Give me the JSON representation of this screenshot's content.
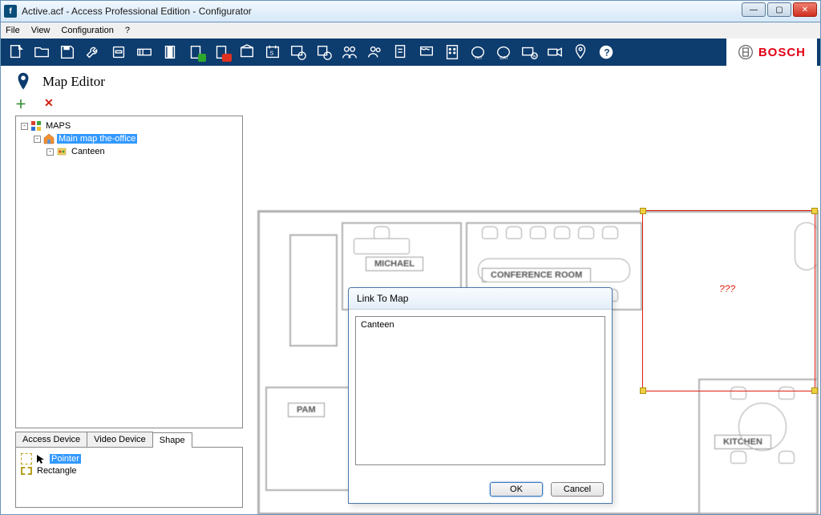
{
  "window": {
    "title": "Active.acf - Access Professional Edition - Configurator",
    "app_icon_glyph": "f"
  },
  "menu": {
    "items": [
      "File",
      "View",
      "Configuration",
      "?"
    ]
  },
  "brand": {
    "text": "BOSCH"
  },
  "map_editor": {
    "title": "Map Editor"
  },
  "tree": {
    "root": "MAPS",
    "children": [
      {
        "label": "Main map the-office",
        "selected": true
      },
      {
        "label": "Canteen",
        "selected": false
      }
    ]
  },
  "tabs": {
    "items": [
      "Access Device",
      "Video Device",
      "Shape"
    ],
    "active": 2
  },
  "shape_list": [
    {
      "label": "Pointer",
      "selected": true
    },
    {
      "label": "Rectangle",
      "selected": false
    }
  ],
  "floorplan": {
    "rooms": [
      "MICHAEL",
      "CONFERENCE ROOM",
      "PAM",
      "KITCHEN"
    ],
    "selection_marker": "???"
  },
  "dialog": {
    "title": "Link To Map",
    "list_item": "Canteen",
    "ok": "OK",
    "cancel": "Cancel"
  }
}
